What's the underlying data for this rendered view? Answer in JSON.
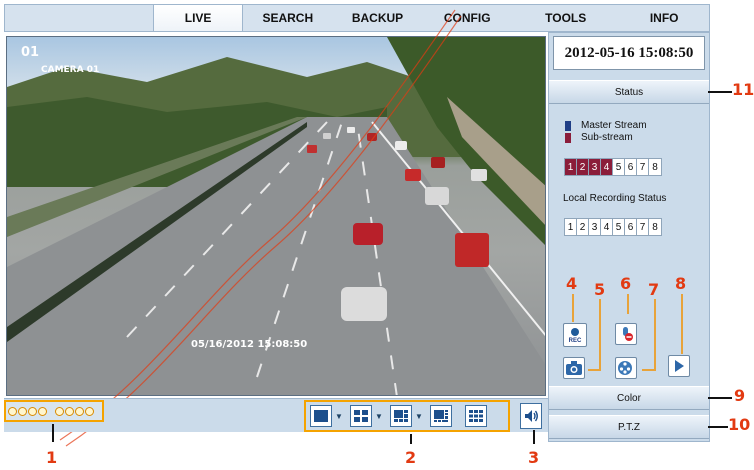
{
  "menu": {
    "tabs": [
      "LIVE",
      "SEARCH",
      "BACKUP",
      "CONFIG",
      "TOOLS",
      "INFO"
    ]
  },
  "video": {
    "channel_number": "01",
    "camera_name": "CAMERA 01",
    "overlay_timestamp": "05/16/2012 15:08:50"
  },
  "panel": {
    "datetime": "2012-05-16 15:08:50",
    "status_label": "Status",
    "legend_master": "Master Stream",
    "legend_sub": "Sub-stream",
    "legend_master_color": "#1f3e86",
    "legend_sub_color": "#8b1d3a",
    "stream_channels": [
      "1",
      "2",
      "3",
      "4",
      "5",
      "6",
      "7",
      "8"
    ],
    "stream_active_count": 4,
    "local_recording_label": "Local Recording Status",
    "record_channels": [
      "1",
      "2",
      "3",
      "4",
      "5",
      "6",
      "7",
      "8"
    ],
    "rec_icon_label": "REC",
    "color_label": "Color",
    "ptz_label": "P.T.Z"
  },
  "callouts": {
    "c1": "1",
    "c2": "2",
    "c3": "3",
    "c4": "4",
    "c5": "5",
    "c6": "6",
    "c7": "7",
    "c8": "8",
    "c9": "9",
    "c10": "10",
    "c11": "11"
  },
  "callout_color": "#e23a12",
  "highlight_color": "#f5a300"
}
